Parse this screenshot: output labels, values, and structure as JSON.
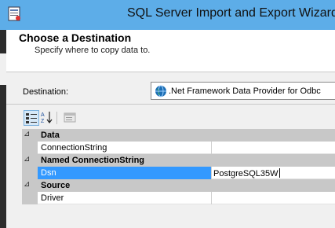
{
  "window": {
    "title": "SQL Server Import and Export Wizard"
  },
  "header": {
    "title": "Choose a Destination",
    "subtitle": "Specify where to copy data to."
  },
  "destination": {
    "label": "Destination:",
    "value": ".Net Framework Data Provider for Odbc"
  },
  "toolbar": {
    "buttons": [
      "categorized-icon",
      "alphabetical-icon",
      "property-pages-icon"
    ]
  },
  "grid": {
    "categories": [
      {
        "name": "Data",
        "toggle": "⊿",
        "properties": [
          {
            "name": "ConnectionString",
            "value": ""
          }
        ]
      },
      {
        "name": "Named ConnectionString",
        "toggle": "⊿",
        "properties": [
          {
            "name": "Dsn",
            "value": "PostgreSQL35W"
          }
        ]
      },
      {
        "name": "Source",
        "toggle": "⊿",
        "properties": [
          {
            "name": "Driver",
            "value": ""
          }
        ]
      }
    ]
  },
  "colors": {
    "titlebar": "#5dade8",
    "selection": "#3399ff",
    "category": "#c8c8c8"
  }
}
